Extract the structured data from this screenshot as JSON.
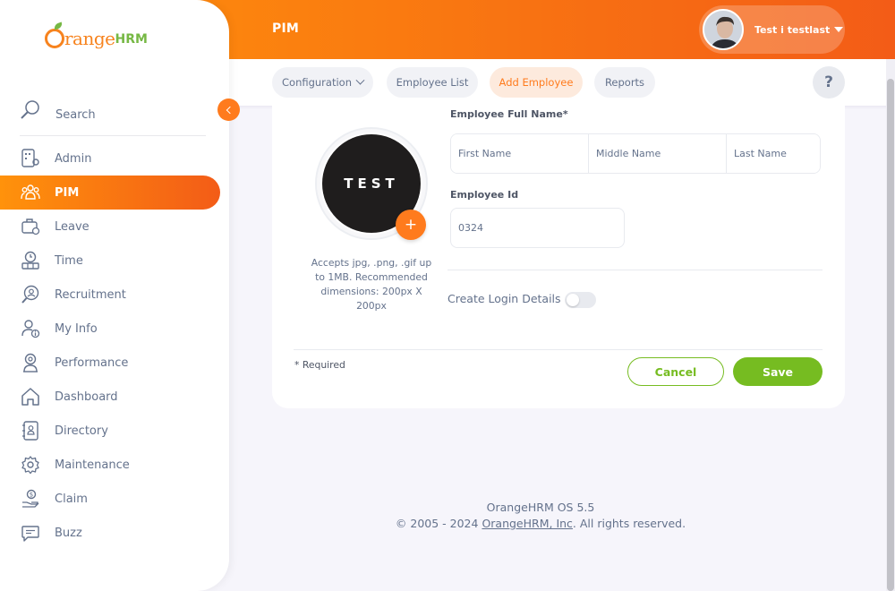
{
  "header": {
    "module": "PIM",
    "user_name": "Test i testlast"
  },
  "subnav": {
    "configuration": "Configuration",
    "employee_list": "Employee List",
    "add_employee": "Add Employee",
    "reports": "Reports",
    "help": "?"
  },
  "sidebar": {
    "logo_orange": "range",
    "logo_hrm": "HRM",
    "search": "Search",
    "items": [
      {
        "label": "Admin"
      },
      {
        "label": "PIM"
      },
      {
        "label": "Leave"
      },
      {
        "label": "Time"
      },
      {
        "label": "Recruitment"
      },
      {
        "label": "My Info"
      },
      {
        "label": "Performance"
      },
      {
        "label": "Dashboard"
      },
      {
        "label": "Directory"
      },
      {
        "label": "Maintenance"
      },
      {
        "label": "Claim"
      },
      {
        "label": "Buzz"
      }
    ]
  },
  "form": {
    "photo_text": "TEST",
    "photo_add": "+",
    "photo_hint": "Accepts jpg, .png, .gif up to 1MB. Recommended dimensions: 200px X 200px",
    "full_name_label": "Employee Full Name*",
    "first_name_placeholder": "First Name",
    "middle_name_placeholder": "Middle Name",
    "last_name_placeholder": "Last Name",
    "employee_id_label": "Employee Id",
    "employee_id_value": "0324",
    "create_login_label": "Create Login Details",
    "create_login_enabled": false,
    "required_note": "* Required",
    "cancel": "Cancel",
    "save": "Save"
  },
  "footer": {
    "version": "OrangeHRM OS 5.5",
    "copyright_prefix": "© 2005 - 2024 ",
    "company_link": "OrangeHRM, Inc",
    "copyright_suffix": ". All rights reserved."
  },
  "colors": {
    "brand_orange": "#ff7b1d",
    "brand_green": "#76bc21",
    "text": "#64728c"
  }
}
